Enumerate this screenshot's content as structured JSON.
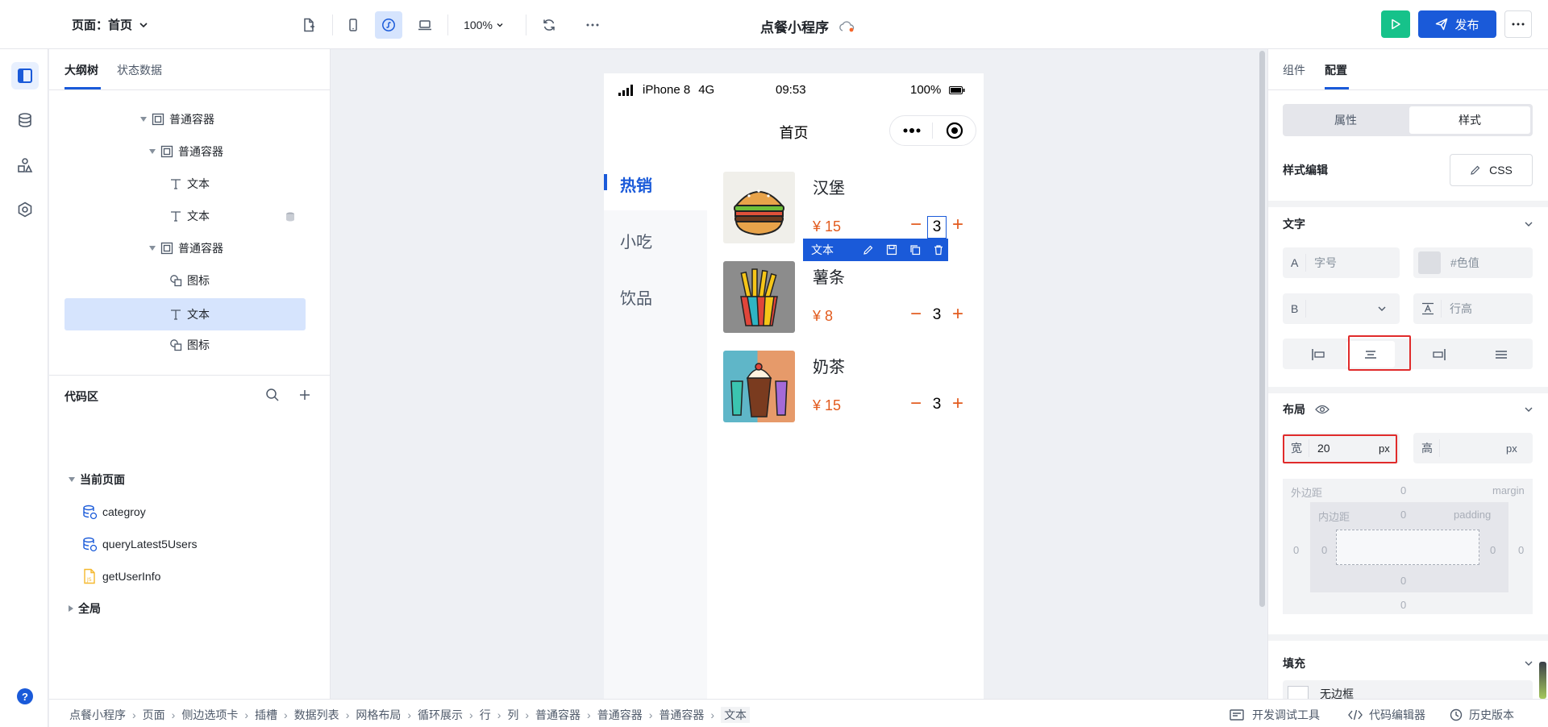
{
  "topbar": {
    "page_label": "页面：首页",
    "zoom": "100%",
    "app_title": "点餐小程序",
    "publish_label": "发布"
  },
  "left_panel": {
    "tabs": [
      "大纲树",
      "状态数据"
    ],
    "tree": [
      {
        "label": "普通容器",
        "icon": "container-icon"
      },
      {
        "label": "普通容器",
        "icon": "container-icon"
      },
      {
        "label": "文本",
        "icon": "text-icon"
      },
      {
        "label": "文本",
        "icon": "text-icon"
      },
      {
        "label": "普通容器",
        "icon": "container-icon"
      },
      {
        "label": "图标",
        "icon": "shapes-icon"
      },
      {
        "label": "文本",
        "icon": "text-icon",
        "selected": true
      },
      {
        "label": "图标",
        "icon": "shapes-icon"
      }
    ],
    "code_section": {
      "title": "代码区",
      "current_page": "当前页面",
      "items": [
        "categroy",
        "queryLatest5Users",
        "getUserInfo"
      ],
      "global": "全局"
    }
  },
  "phone": {
    "status": {
      "device": "iPhone 8",
      "network": "4G",
      "time": "09:53",
      "battery": "100%"
    },
    "nav_title": "首页",
    "categories": [
      "热销",
      "小吃",
      "饮品"
    ],
    "items": [
      {
        "name": "汉堡",
        "price": "¥ 15",
        "qty": "3"
      },
      {
        "name": "薯条",
        "price": "¥ 8",
        "qty": "3"
      },
      {
        "name": "奶茶",
        "price": "¥ 15",
        "qty": "3"
      }
    ],
    "toolbar_label": "文本",
    "qty_minus": "−",
    "qty_plus": "+"
  },
  "right_panel": {
    "tabs": [
      "组件",
      "配置"
    ],
    "segment": [
      "属性",
      "样式"
    ],
    "style_edit_label": "样式编辑",
    "css_button": "CSS",
    "text_section": "文字",
    "font_size_prefix": "A",
    "font_size_placeholder": "字号",
    "color_placeholder": "#色值",
    "bold_prefix": "B",
    "line_height_placeholder": "行高",
    "layout_section": "布局",
    "width_label": "宽",
    "width_value": "20",
    "width_unit": "px",
    "height_label": "高",
    "height_unit": "px",
    "margin_label": "外边距",
    "margin_word": "margin",
    "padding_label": "内边距",
    "padding_word": "padding",
    "zero": "0",
    "fill_section": "填充",
    "fill_partial": "无边框"
  },
  "bottombar": {
    "breadcrumb": [
      "点餐小程序",
      "页面",
      "侧边选项卡",
      "插槽",
      "数据列表",
      "网格布局",
      "循环展示",
      "行",
      "列",
      "普通容器",
      "普通容器",
      "普通容器",
      "文本"
    ],
    "dev_tools": "开发调试工具",
    "code_editor": "代码编辑器",
    "history": "历史版本"
  },
  "colors": {
    "accent": "#1a5ad9",
    "price": "#e25b1e",
    "run": "#16c28a",
    "selection": "#d6e4fd",
    "highlight": "#e02b2b"
  }
}
